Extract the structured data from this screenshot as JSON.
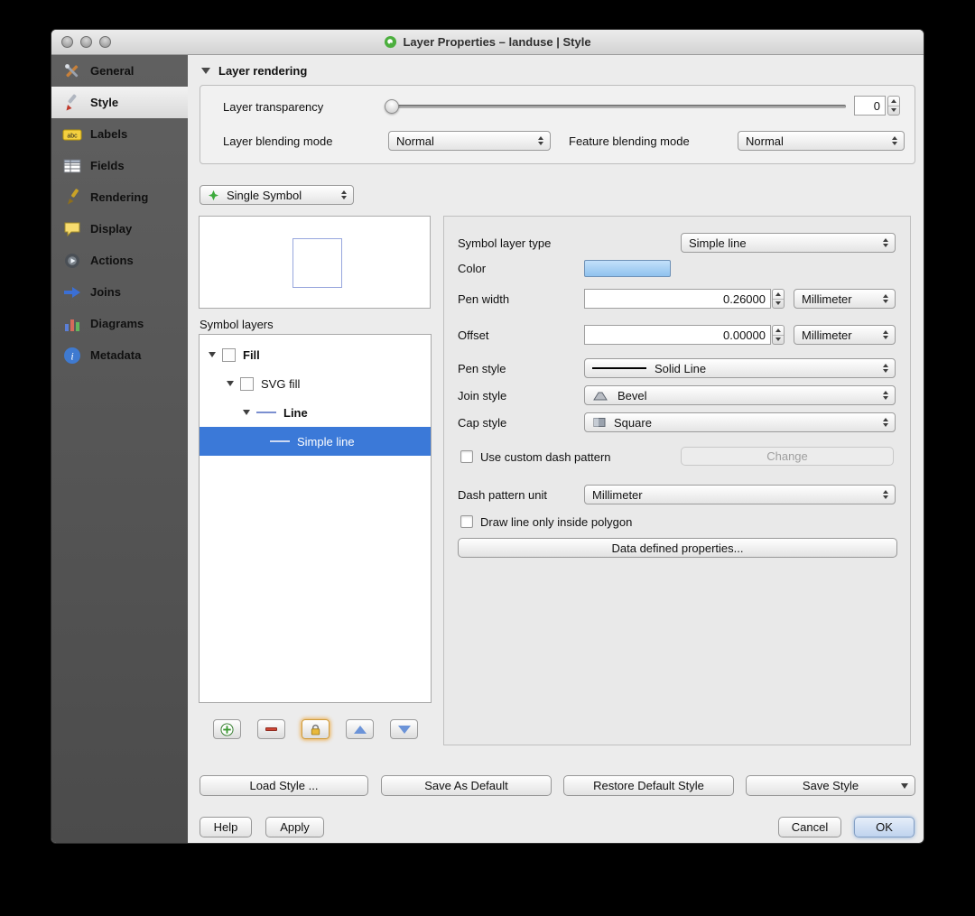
{
  "window": {
    "title": "Layer Properties – landuse | Style"
  },
  "sidebar": {
    "items": [
      {
        "label": "General",
        "icon": "tools-icon"
      },
      {
        "label": "Style",
        "icon": "style-brush-icon",
        "selected": true
      },
      {
        "label": "Labels",
        "icon": "abc-labels-icon"
      },
      {
        "label": "Fields",
        "icon": "fields-table-icon"
      },
      {
        "label": "Rendering",
        "icon": "rendering-brush-icon"
      },
      {
        "label": "Display",
        "icon": "display-bubble-icon"
      },
      {
        "label": "Actions",
        "icon": "actions-gear-icon"
      },
      {
        "label": "Joins",
        "icon": "joins-arrow-icon"
      },
      {
        "label": "Diagrams",
        "icon": "diagrams-chart-icon"
      },
      {
        "label": "Metadata",
        "icon": "metadata-info-icon"
      }
    ]
  },
  "layer_rendering": {
    "title": "Layer rendering",
    "transparency_label": "Layer transparency",
    "transparency_value": "0",
    "layer_blending_label": "Layer blending mode",
    "layer_blending_value": "Normal",
    "feature_blending_label": "Feature blending mode",
    "feature_blending_value": "Normal"
  },
  "renderer": {
    "value": "Single Symbol"
  },
  "symbol_layers": {
    "label": "Symbol layers",
    "tree": [
      {
        "label": "Fill",
        "level": 0,
        "bold": true,
        "swatch": "fill-square"
      },
      {
        "label": "SVG fill",
        "level": 1,
        "bold": false,
        "swatch": "fill-square"
      },
      {
        "label": "Line",
        "level": 2,
        "bold": true,
        "swatch": "line"
      },
      {
        "label": "Simple line",
        "level": 3,
        "bold": false,
        "swatch": "line",
        "selected": true
      }
    ]
  },
  "properties": {
    "symbol_layer_type": {
      "label": "Symbol layer type",
      "value": "Simple line"
    },
    "color": {
      "label": "Color",
      "swatch": "#a4cdf2"
    },
    "pen_width": {
      "label": "Pen width",
      "value": "0.26000",
      "unit": "Millimeter"
    },
    "offset": {
      "label": "Offset",
      "value": "0.00000",
      "unit": "Millimeter"
    },
    "pen_style": {
      "label": "Pen style",
      "value": "Solid Line"
    },
    "join_style": {
      "label": "Join style",
      "value": "Bevel"
    },
    "cap_style": {
      "label": "Cap style",
      "value": "Square"
    },
    "custom_dash": {
      "label": "Use custom dash pattern",
      "checked": false,
      "button": "Change"
    },
    "dash_pattern_unit": {
      "label": "Dash pattern unit",
      "value": "Millimeter"
    },
    "draw_inside": {
      "label": "Draw line only inside polygon",
      "checked": false
    },
    "data_defined": {
      "label": "Data defined properties..."
    }
  },
  "style_actions": {
    "load": "Load Style ...",
    "save_default": "Save As Default",
    "restore_default": "Restore Default Style",
    "save_style": "Save Style"
  },
  "dialog_actions": {
    "help": "Help",
    "apply": "Apply",
    "cancel": "Cancel",
    "ok": "OK"
  },
  "icons": {
    "add-symbol-layer-icon": "green-plus-circle",
    "remove-symbol-layer-icon": "red-minus-bar",
    "lock-color-icon": "yellow-padlock",
    "move-up-icon": "blue-up-arrow",
    "move-down-icon": "blue-down-arrow",
    "dropdown-arrows-icon": "stacked-triangles",
    "disclosure-triangle-icon": "down-triangle"
  },
  "colors": {
    "selection": "#3b79d8",
    "color_swatch": "#a4cdf2",
    "sidebar_bg": "#565656"
  }
}
